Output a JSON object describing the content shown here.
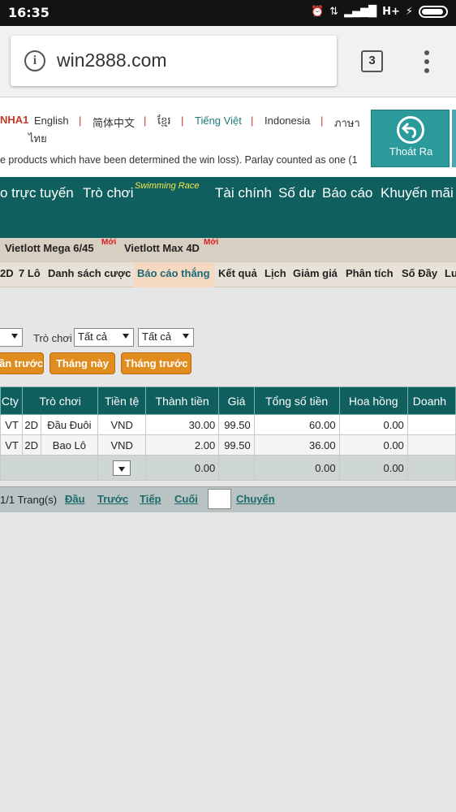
{
  "status_bar": {
    "time": "16:35",
    "network": "H+"
  },
  "browser": {
    "url": "win2888.com",
    "tab_count": "3"
  },
  "languages": {
    "brand_partial": "NHA1",
    "items": [
      "English",
      "简体中文",
      "ខ្មែរ",
      "Tiếng Việt",
      "Indonesia",
      "ภาษา"
    ],
    "thai_second_line": "ไทย",
    "separator": "|"
  },
  "marquee_text": "e products which have been determined the win loss). Parlay counted as one (1",
  "logout_label": "Thoát Ra",
  "main_nav": {
    "items": [
      "o trực tuyến",
      "Trò chơi",
      "Tài chính",
      "Số dư",
      "Báo cáo",
      "Khuyến mãi"
    ],
    "badge": "Swimming Race"
  },
  "sub_nav1": {
    "items": [
      "Vietlott Mega 6/45",
      "Vietlott Max 4D"
    ],
    "new_badge": "Mới"
  },
  "sub_nav2": {
    "items": [
      "2D",
      "7 Lô",
      "Danh sách cược",
      "Báo cáo thắng",
      "Kết quả",
      "Lịch",
      "Giảm giá",
      "Phân tích",
      "Số Đầy",
      "Lu"
    ],
    "active": "Báo cáo thắng"
  },
  "filters": {
    "game_label": "Trò chơi",
    "select1": "Tất cả",
    "select2": "Tất cả",
    "buttons": [
      "ần trước",
      "Tháng này",
      "Tháng trước"
    ]
  },
  "table": {
    "headers": [
      "Cty",
      "Trò chơi",
      "Tiền tệ",
      "Thành tiền",
      "Giá",
      "Tổng số tiền",
      "Hoa hồng",
      "Doanh"
    ],
    "rows": [
      {
        "cty": "VT",
        "type": "2D",
        "game": "Đầu Đuôi",
        "currency": "VND",
        "amount": "30.00",
        "price": "99.50",
        "total": "60.00",
        "commission": "0.00"
      },
      {
        "cty": "VT",
        "type": "2D",
        "game": "Bao Lô",
        "currency": "VND",
        "amount": "2.00",
        "price": "99.50",
        "total": "36.00",
        "commission": "0.00"
      }
    ],
    "totals": {
      "amount": "0.00",
      "total": "0.00",
      "commission": "0.00"
    }
  },
  "pager": {
    "info": "1/1 Trang(s)",
    "first": "Đầu",
    "prev": "Trước",
    "next": "Tiếp",
    "last": "Cuối",
    "go": "Chuyển"
  }
}
